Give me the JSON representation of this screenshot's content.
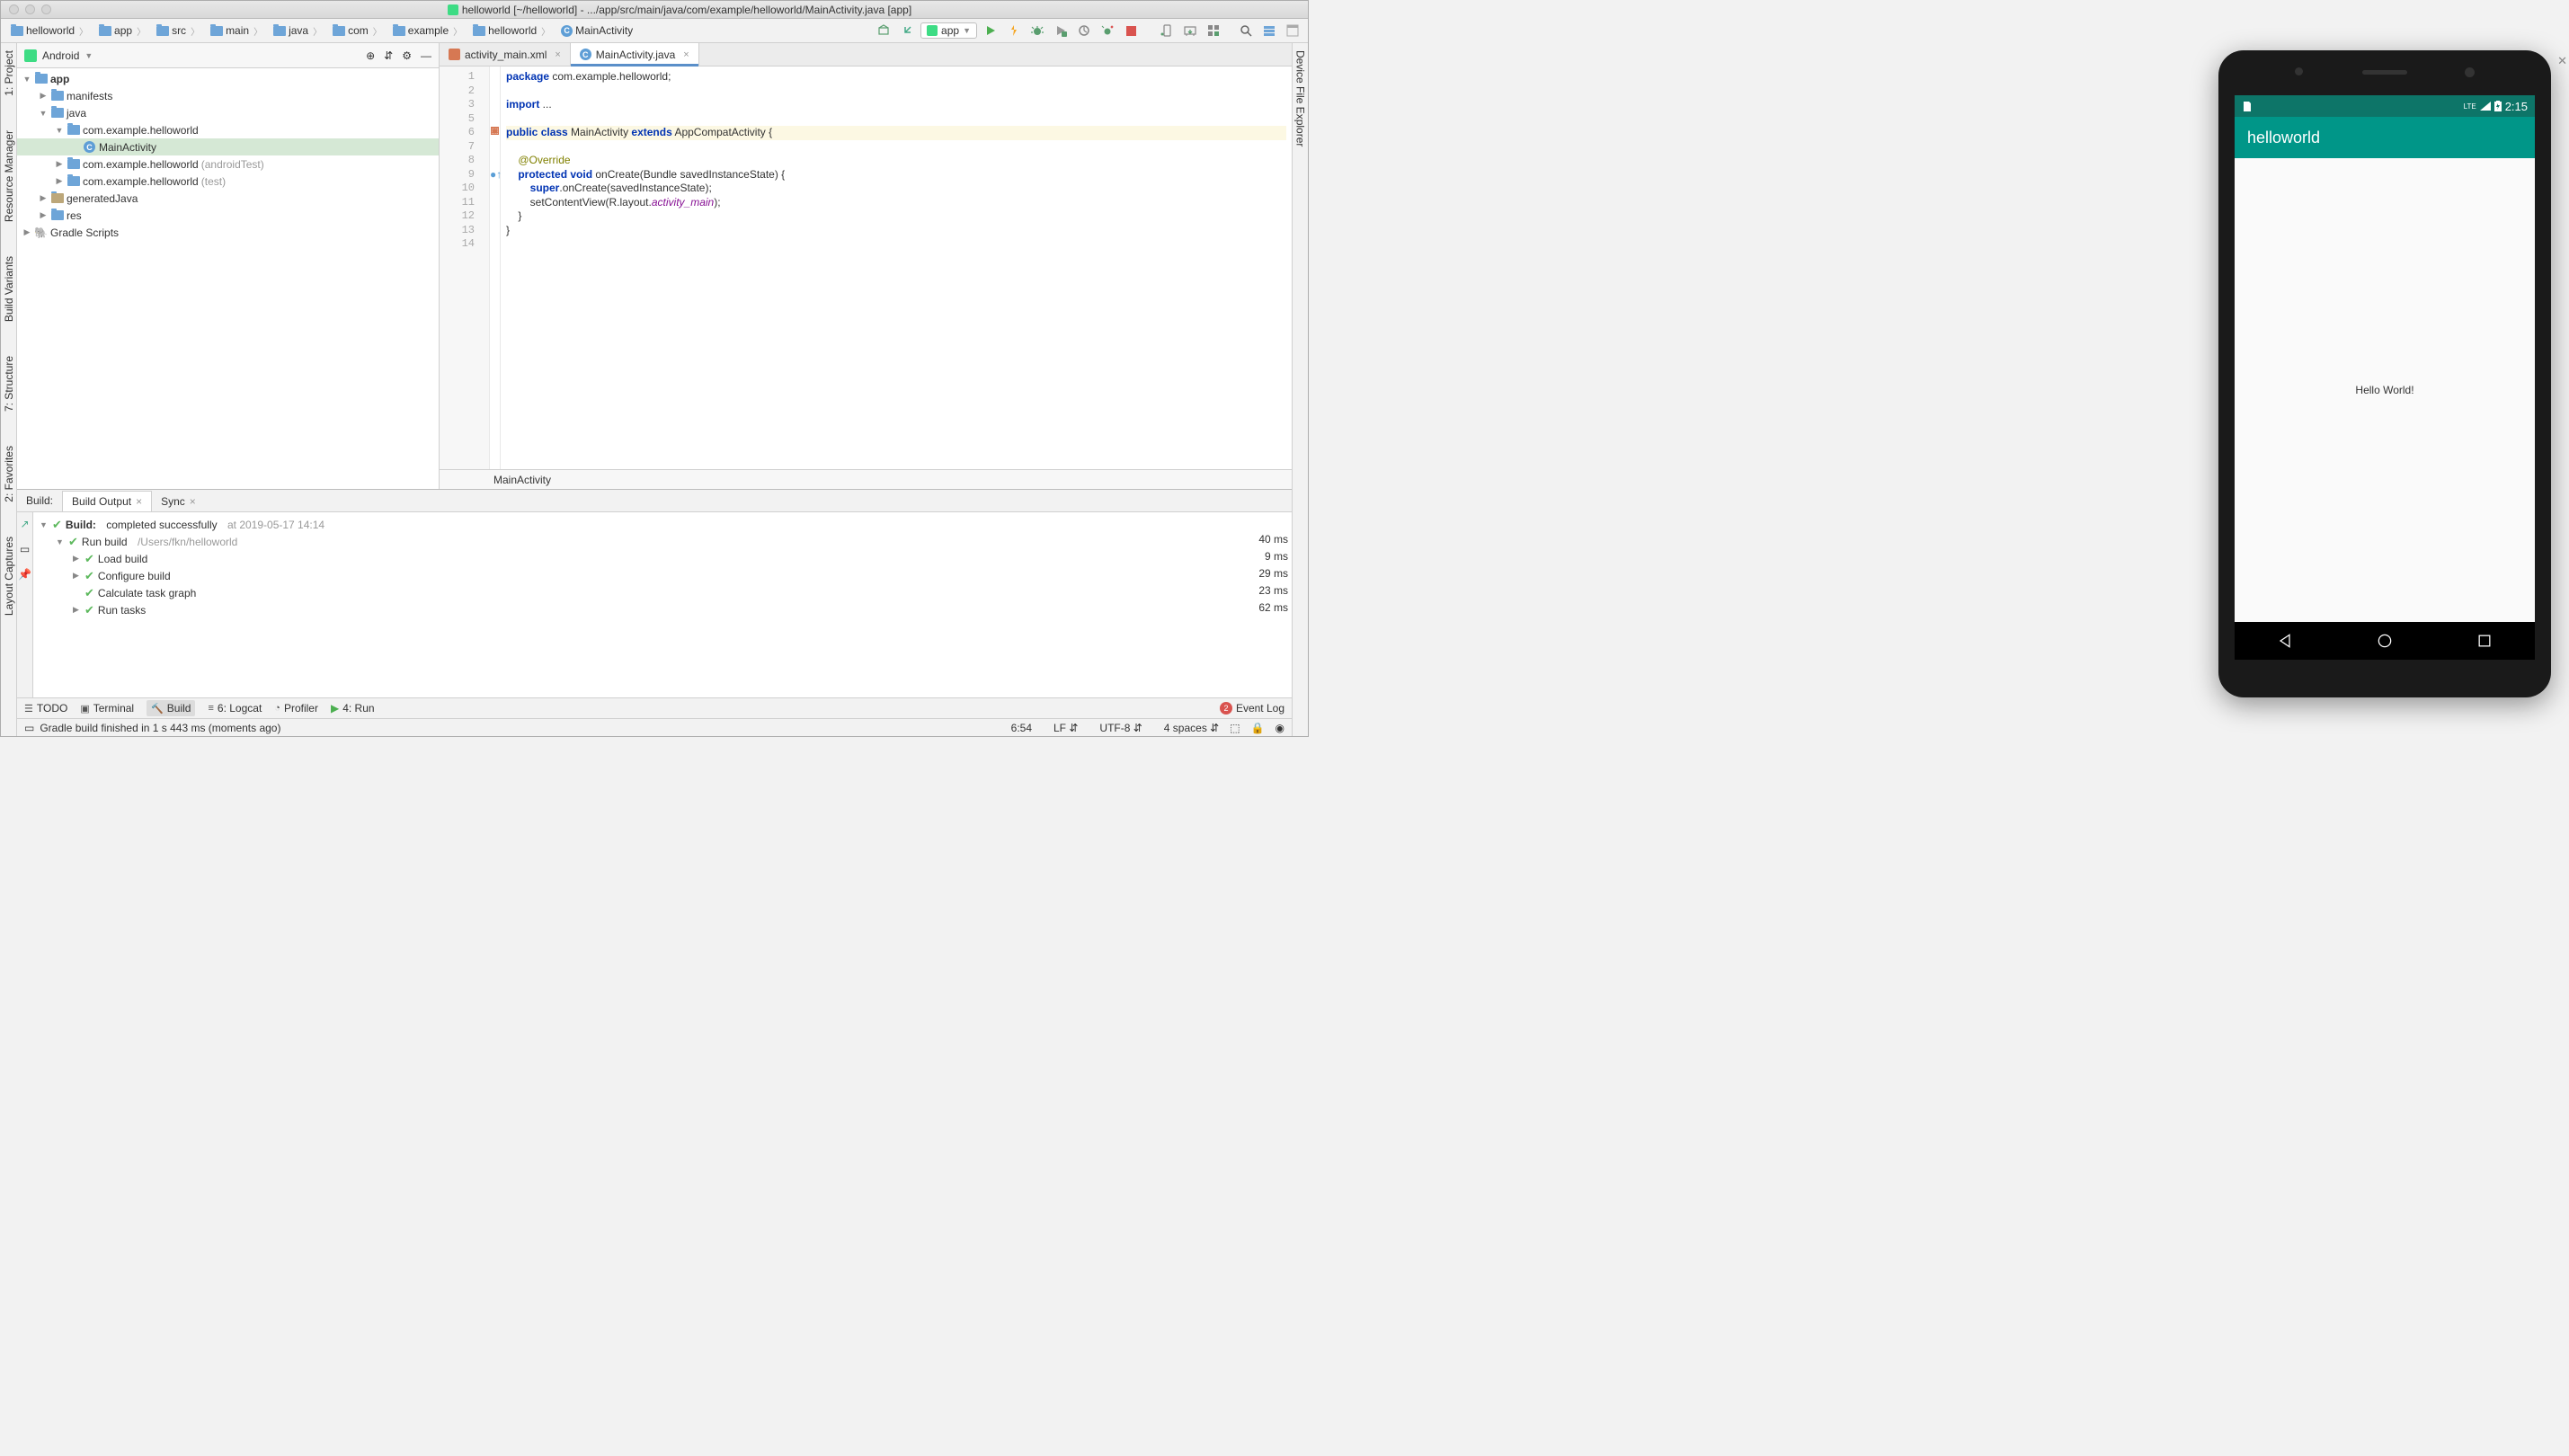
{
  "window_title": "helloworld [~/helloworld] - .../app/src/main/java/com/example/helloworld/MainActivity.java [app]",
  "breadcrumbs": [
    "helloworld",
    "app",
    "src",
    "main",
    "java",
    "com",
    "example",
    "helloworld",
    "MainActivity"
  ],
  "run_config_label": "app",
  "project_panel": {
    "selector": "Android",
    "tree": [
      {
        "depth": 0,
        "arrow": "down",
        "icon": "folder",
        "label": "app",
        "bold": true
      },
      {
        "depth": 1,
        "arrow": "right",
        "icon": "folder",
        "label": "manifests"
      },
      {
        "depth": 1,
        "arrow": "down",
        "icon": "folder",
        "label": "java"
      },
      {
        "depth": 2,
        "arrow": "down",
        "icon": "folder",
        "label": "com.example.helloworld"
      },
      {
        "depth": 3,
        "arrow": "",
        "icon": "class",
        "label": "MainActivity",
        "selected": true
      },
      {
        "depth": 2,
        "arrow": "right",
        "icon": "folder",
        "label": "com.example.helloworld",
        "suffix": " (androidTest)"
      },
      {
        "depth": 2,
        "arrow": "right",
        "icon": "folder",
        "label": "com.example.helloworld",
        "suffix": " (test)"
      },
      {
        "depth": 1,
        "arrow": "right",
        "icon": "folder-gen",
        "label": "generatedJava"
      },
      {
        "depth": 1,
        "arrow": "right",
        "icon": "folder",
        "label": "res"
      },
      {
        "depth": 0,
        "arrow": "right",
        "icon": "gradle",
        "label": "Gradle Scripts"
      }
    ]
  },
  "tabs": [
    {
      "icon": "xml",
      "label": "activity_main.xml",
      "active": false
    },
    {
      "icon": "class",
      "label": "MainActivity.java",
      "active": true
    }
  ],
  "code_lines": [
    {
      "n": 1,
      "html": "<span class=\"kw\">package</span> com.example.helloworld;"
    },
    {
      "n": 2,
      "html": ""
    },
    {
      "n": 3,
      "html": "<span class=\"kw\">import</span> ..."
    },
    {
      "n": 5,
      "html": ""
    },
    {
      "n": 6,
      "html": "<span class=\"kw\">public</span> <span class=\"kw\">class</span> MainActivity <span class=\"kw\">extends</span> AppCompatActivity {",
      "hl": true
    },
    {
      "n": 7,
      "html": ""
    },
    {
      "n": 8,
      "html": "    <span class=\"anno\">@Override</span>"
    },
    {
      "n": 9,
      "html": "    <span class=\"kw\">protected</span> <span class=\"kw\">void</span> onCreate(Bundle savedInstanceState) {"
    },
    {
      "n": 10,
      "html": "        <span class=\"kw\">super</span>.onCreate(savedInstanceState);"
    },
    {
      "n": 11,
      "html": "        setContentView(R.layout.<span class=\"ital\">activity_main</span>);"
    },
    {
      "n": 12,
      "html": "    }"
    },
    {
      "n": 13,
      "html": "}"
    },
    {
      "n": 14,
      "html": ""
    }
  ],
  "editor_breadcrumb": "MainActivity",
  "left_tool_strip": [
    "1: Project",
    "Resource Manager",
    "Build Variants",
    "7: Structure",
    "2: Favorites",
    "Layout Captures"
  ],
  "right_tool_strip": [
    "Device File Explorer"
  ],
  "build": {
    "tabs_label": "Build:",
    "tabs": [
      {
        "label": "Build Output",
        "active": true
      },
      {
        "label": "Sync",
        "active": false
      }
    ],
    "root": {
      "label": "Build:",
      "status": "completed successfully",
      "ts": "at 2019-05-17 14:14"
    },
    "run_build": {
      "label": "Run build",
      "path": "/Users/fkn/helloworld"
    },
    "tasks": [
      "Load build",
      "Configure build",
      "Calculate task graph",
      "Run tasks"
    ],
    "times": [
      "40 ms",
      "9 ms",
      "29 ms",
      "23 ms",
      "62 ms"
    ]
  },
  "bottom_tools": [
    "TODO",
    "Terminal",
    "Build",
    "6: Logcat",
    "Profiler",
    "4: Run"
  ],
  "event_log": {
    "count": "2",
    "label": "Event Log"
  },
  "status_message": "Gradle build finished in 1 s 443 ms (moments ago)",
  "status_right": {
    "pos": "6:54",
    "le": "LF",
    "enc": "UTF-8",
    "indent": "4 spaces"
  },
  "emulator": {
    "status": {
      "lte": "LTE",
      "time": "2:15"
    },
    "app_title": "helloworld",
    "content_text": "Hello World!"
  }
}
